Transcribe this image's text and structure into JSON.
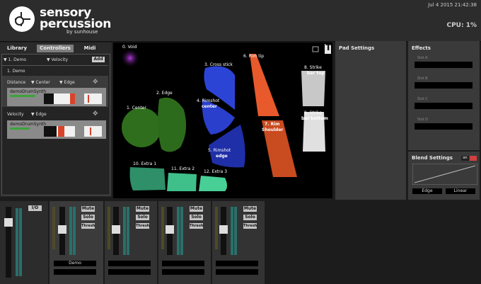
{
  "app": {
    "brand_line1": "sensory",
    "brand_line2": "percussion",
    "brand_sub": "by sunhouse",
    "datetime": "Jul  4 2015 21:42:38",
    "cpu": "CPU: 1%"
  },
  "left_tabs": [
    "Library",
    "Controllers",
    "Midi"
  ],
  "controllers": {
    "demo_dropdown": "1. Demo",
    "velocity_dropdown": "Velocity",
    "add_label": "Add",
    "section_title": "1. Demo",
    "mod1": {
      "source": "Distance",
      "from": "Center",
      "to": "Edge"
    },
    "mod1_synth": "demoDrumSynth",
    "mod2": {
      "source": "Velocity",
      "to": "Edge"
    },
    "mod2_synth": "demoDrumSynth"
  },
  "zones": {
    "void": "0. Void",
    "center": "1. Center",
    "edge": "2. Edge",
    "cross_stick": "3. Cross stick",
    "rimshot_center_a": "4. Rimshot",
    "rimshot_center_b": "center",
    "rimshot_edge_a": "5. Rimshot",
    "rimshot_edge_b": "edge",
    "rim_tip": "6. Rim tip",
    "rim_shoulder_a": "7. Rim",
    "rim_shoulder_b": "Shoulder",
    "strike_top_a": "8. Strike",
    "strike_top_b": "bar top",
    "strike_bottom_a": "9. Strike",
    "strike_bottom_b": "bar bottom",
    "extra1": "10. Extra 1",
    "extra2": "11. Extra 2",
    "extra3": "12. Extra 3",
    "t_icon": "T"
  },
  "pad_settings": {
    "title": "Pad Settings"
  },
  "effects": {
    "title": "Effects",
    "slots": [
      "Slot A",
      "Slot B",
      "Slot C",
      "Slot D"
    ]
  },
  "blend": {
    "title": "Blend Settings",
    "toggle": "on",
    "left": "Edge",
    "right": "Linear"
  },
  "mixer": {
    "io_label": "I/O",
    "mute": "Mute",
    "solo": "Solo",
    "thresh": "Thresh",
    "channel1_name": "Demo"
  },
  "colors": {
    "blue": "#2b3fc9",
    "orange": "#e55a2a",
    "green": "#2e6f1d",
    "teal": "#3fbf8a",
    "purple": "#9a2bd0",
    "meter_teal": "#2a6f6a"
  }
}
